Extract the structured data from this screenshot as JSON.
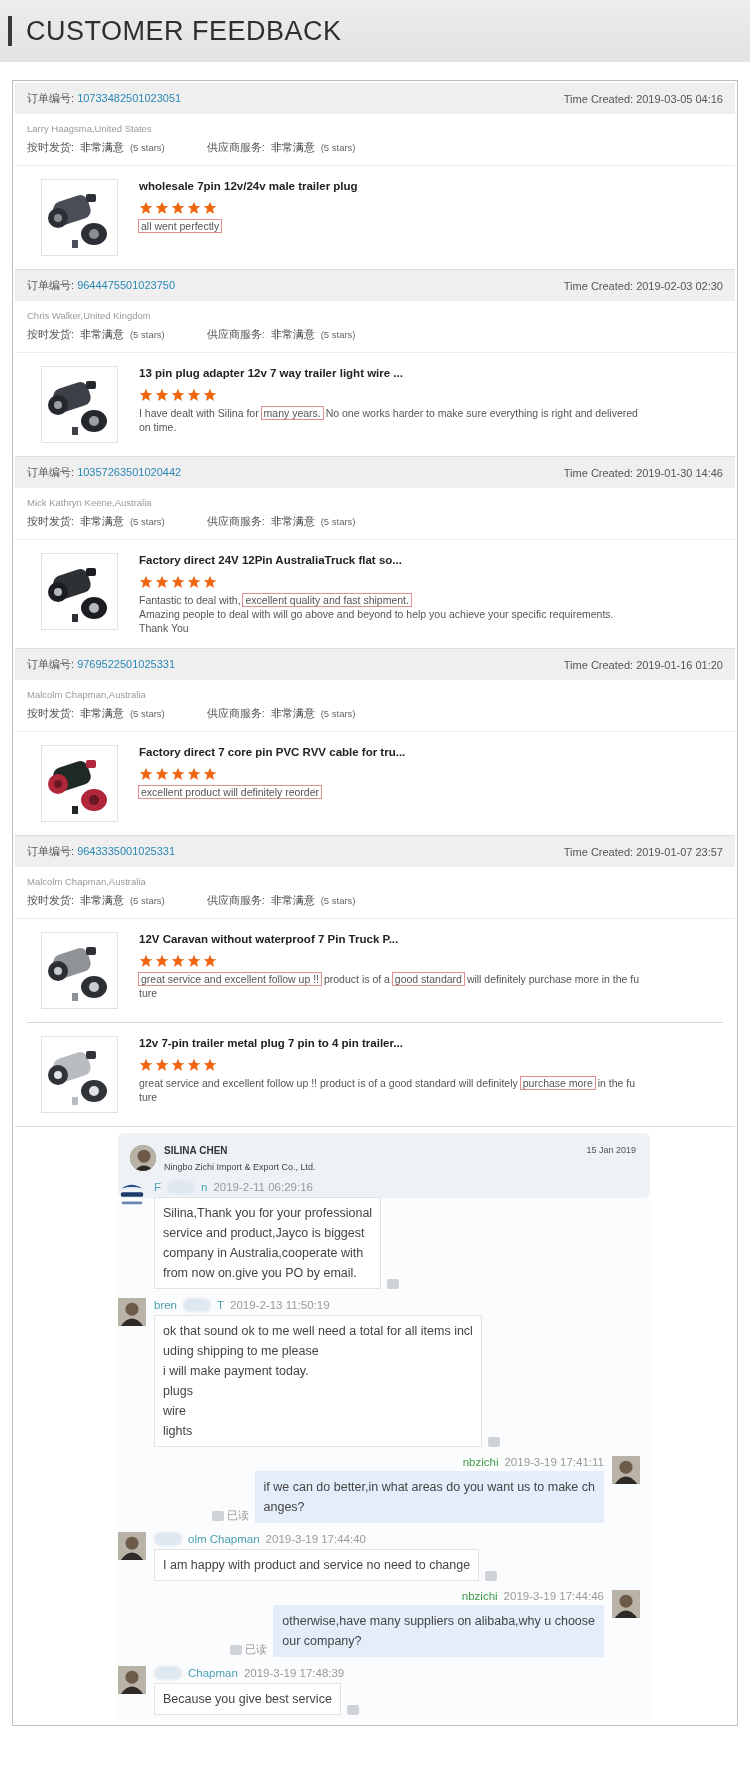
{
  "header": {
    "title": "CUSTOMER FEEDBACK"
  },
  "orders": [
    {
      "order_label": "订单编号:",
      "order_number": "10733482501023051",
      "time_created": "Time Created: 2019-03-05 04:16",
      "buyer": "Larry Haagsma,United States",
      "ratings": [
        {
          "label": "按时发货:",
          "value": "非常满意",
          "note": "(5 stars)"
        },
        {
          "label": "供应商服务:",
          "value": "非常满意",
          "note": "(5 stars)"
        }
      ],
      "products": [
        {
          "title": "wholesale 7pin 12v/24v male trailer plug",
          "stars": 5,
          "review": [
            [
              {
                "text": "all went perfectly",
                "boxed": true
              }
            ]
          ]
        }
      ]
    },
    {
      "order_label": "订单编号:",
      "order_number": "9644475501023750",
      "time_created": "Time Created: 2019-02-03 02:30",
      "buyer": "Chris Walker,United Kingdom",
      "ratings": [
        {
          "label": "按时发货:",
          "value": "非常满意",
          "note": "(5 stars)"
        },
        {
          "label": "供应商服务:",
          "value": "非常满意",
          "note": "(5 stars)"
        }
      ],
      "products": [
        {
          "title": "13 pin plug adapter 12v 7 way trailer light wire ...",
          "stars": 5,
          "review": [
            [
              {
                "text": "I have dealt with Silina for",
                "boxed": false
              },
              {
                "text": "many years.",
                "boxed": true
              },
              {
                "text": "No one works harder to make sure everything is right and delivered",
                "boxed": false
              }
            ],
            [
              {
                "text": "on time.",
                "boxed": false
              }
            ]
          ]
        }
      ]
    },
    {
      "order_label": "订单编号:",
      "order_number": "10357263501020442",
      "time_created": "Time Created: 2019-01-30 14:46",
      "buyer": "Mick Kathryn Keene,Australia",
      "ratings": [
        {
          "label": "按时发货:",
          "value": "非常满意",
          "note": "(5 stars)"
        },
        {
          "label": "供应商服务:",
          "value": "非常满意",
          "note": "(5 stars)"
        }
      ],
      "products": [
        {
          "title": "Factory direct 24V 12Pin AustraliaTruck flat so...",
          "stars": 5,
          "review": [
            [
              {
                "text": "Fantastic to deal with,",
                "boxed": false
              },
              {
                "text": "excellent quality and fast shipment.",
                "boxed": true
              }
            ],
            [
              {
                "text": "Amazing people to deal with will go above and beyond to help you achieve your specific requirements.",
                "boxed": false
              }
            ],
            [
              {
                "text": "Thank You",
                "boxed": false
              }
            ]
          ]
        }
      ]
    },
    {
      "order_label": "订单编号:",
      "order_number": "9769522501025331",
      "time_created": "Time Created: 2019-01-16 01:20",
      "buyer": "Malcolm Chapman,Australia",
      "ratings": [
        {
          "label": "按时发货:",
          "value": "非常满意",
          "note": "(5 stars)"
        },
        {
          "label": "供应商服务:",
          "value": "非常满意",
          "note": "(5 stars)"
        }
      ],
      "products": [
        {
          "title": "Factory direct 7 core pin PVC RVV cable for tru...",
          "stars": 5,
          "review": [
            [
              {
                "text": "excellent product will definitely reorder",
                "boxed": true
              }
            ]
          ]
        }
      ]
    },
    {
      "order_label": "订单编号:",
      "order_number": "9643335001025331",
      "time_created": "Time Created: 2019-01-07 23:57",
      "buyer": "Malcolm Chapman,Australia",
      "ratings": [
        {
          "label": "按时发货:",
          "value": "非常满意",
          "note": "(5 stars)"
        },
        {
          "label": "供应商服务:",
          "value": "非常满意",
          "note": "(5 stars)"
        }
      ],
      "products": [
        {
          "title": "12V Caravan without waterproof 7 Pin Truck P...",
          "stars": 5,
          "review": [
            [
              {
                "text": "great service and excellent follow up !!",
                "boxed": true
              },
              {
                "text": "product is of a",
                "boxed": false
              },
              {
                "text": "good standard",
                "boxed": true
              },
              {
                "text": "will definitely purchase more in the fu",
                "boxed": false
              }
            ],
            [
              {
                "text": "ture",
                "boxed": false
              }
            ]
          ]
        },
        {
          "title": "12v 7-pin trailer metal plug 7 pin to 4 pin trailer...",
          "stars": 5,
          "review": [
            [
              {
                "text": "great service and excellent follow up !! product is of a good standard will definitely",
                "boxed": false
              },
              {
                "text": "purchase more",
                "boxed": true
              },
              {
                "text": "in the fu",
                "boxed": false
              }
            ],
            [
              {
                "text": "ture",
                "boxed": false
              }
            ]
          ]
        }
      ]
    }
  ],
  "chat": {
    "contact": {
      "name": "SILINA CHEN",
      "company": "Ningbo Zichi Import & Export Co., Ltd.",
      "date": "15 Jan 2019"
    },
    "messages": [
      {
        "kind": "incoming",
        "sender_parts": [
          "F",
          "n"
        ],
        "prefix_blurred": false,
        "time": "2019-2-11 06:29:16",
        "lines": [
          "Silina,Thank you for your professional",
          "service and product,Jayco is biggest",
          "company in Australia,cooperate with",
          "from now on.give you PO by email."
        ]
      },
      {
        "kind": "incoming",
        "sender_parts": [
          "bren",
          "T"
        ],
        "prefix_blurred": false,
        "time": "2019-2-13 11:50:19",
        "lines": [
          "ok that sound ok to me well need a total for all items incl",
          "uding shipping to me please",
          "i will make payment today.",
          "plugs",
          "wire",
          "lights"
        ]
      },
      {
        "kind": "outgoing",
        "sender_parts": [
          "nbzichi"
        ],
        "time": "2019-3-19 17:41:11",
        "receipt": "已读",
        "lines": [
          "if we can do better,in what areas do you want us to make ch",
          "anges?"
        ]
      },
      {
        "kind": "incoming",
        "sender_parts": [
          "olm Chapman"
        ],
        "prefix_blurred": true,
        "time": "2019-3-19 17:44:40",
        "lines": [
          "I am happy with product and service no need to change"
        ]
      },
      {
        "kind": "outgoing",
        "sender_parts": [
          "nbzichi"
        ],
        "time": "2019-3-19 17:44:46",
        "receipt": "已读",
        "lines": [
          "otherwise,have many suppliers on alibaba,why u choose",
          "our company?"
        ]
      },
      {
        "kind": "incoming",
        "sender_parts": [
          "Chapman"
        ],
        "prefix_blurred": true,
        "time": "2019-3-19 17:48:39",
        "lines": [
          "Because you give best service"
        ]
      }
    ]
  }
}
